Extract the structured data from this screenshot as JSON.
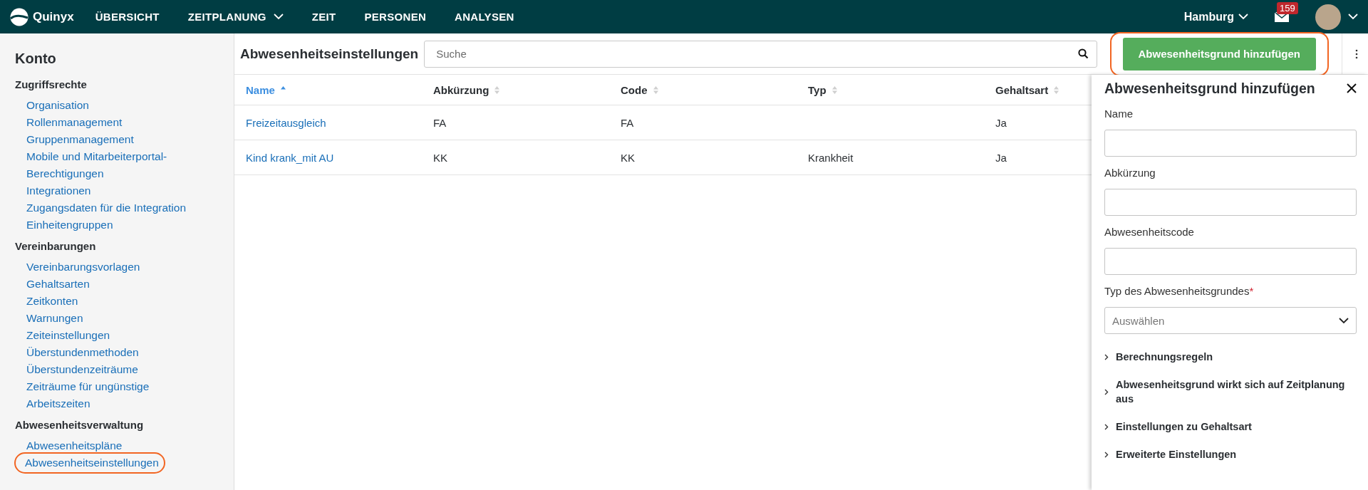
{
  "topbar": {
    "brand": "Quinyx",
    "nav": [
      {
        "label": "ÜBERSICHT",
        "has_menu": false
      },
      {
        "label": "ZEITPLANUNG",
        "has_menu": true
      },
      {
        "label": "ZEIT",
        "has_menu": false
      },
      {
        "label": "PERSONEN",
        "has_menu": false
      },
      {
        "label": "ANALYSEN",
        "has_menu": false
      }
    ],
    "location": "Hamburg",
    "message_count": "159"
  },
  "sidebar": {
    "title": "Konto",
    "groups": [
      {
        "heading": "Zugriffsrechte",
        "items": [
          {
            "label": "Organisation",
            "highlighted": false
          },
          {
            "label": "Rollenmanagement",
            "highlighted": false
          },
          {
            "label": "Gruppenmanagement",
            "highlighted": false
          },
          {
            "label": "Mobile und Mitarbeiterportal-Berechtigungen",
            "highlighted": false
          },
          {
            "label": "Integrationen",
            "highlighted": false
          },
          {
            "label": "Zugangsdaten für die Integration",
            "highlighted": false
          },
          {
            "label": "Einheitengruppen",
            "highlighted": false
          }
        ]
      },
      {
        "heading": "Vereinbarungen",
        "items": [
          {
            "label": "Vereinbarungsvorlagen",
            "highlighted": false
          },
          {
            "label": "Gehaltsarten",
            "highlighted": false
          },
          {
            "label": "Zeitkonten",
            "highlighted": false
          },
          {
            "label": "Warnungen",
            "highlighted": false
          },
          {
            "label": "Zeiteinstellungen",
            "highlighted": false
          },
          {
            "label": "Überstundenmethoden",
            "highlighted": false
          },
          {
            "label": "Überstundenzeiträume",
            "highlighted": false
          },
          {
            "label": "Zeiträume für ungünstige",
            "highlighted": false
          },
          {
            "label": "Arbeitszeiten",
            "highlighted": false
          }
        ]
      },
      {
        "heading": "Abwesenheitsverwaltung",
        "items": [
          {
            "label": "Abwesenheitspläne",
            "highlighted": false
          },
          {
            "label": "Abwesenheitseinstellungen",
            "highlighted": true
          }
        ]
      }
    ]
  },
  "page": {
    "title": "Abwesenheitseinstellungen",
    "search": {
      "placeholder": "Suche"
    },
    "add_button": {
      "label": "Abwesenheitsgrund hinzufügen",
      "highlighted": true
    }
  },
  "table": {
    "columns": [
      {
        "label": "Name",
        "sorted": true
      },
      {
        "label": "Abkürzung",
        "sorted": false
      },
      {
        "label": "Code",
        "sorted": false
      },
      {
        "label": "Typ",
        "sorted": false
      },
      {
        "label": "Gehaltsart",
        "sorted": false
      }
    ],
    "rows": [
      [
        "Freizeitausgleich",
        "FA",
        "FA",
        "",
        "Ja"
      ],
      [
        "Kind krank_mit AU",
        "KK",
        "KK",
        "Krankheit",
        "Ja"
      ]
    ]
  },
  "panel": {
    "title": "Abwesenheitsgrund hinzufügen",
    "fields": [
      {
        "kind": "text",
        "label": "Name"
      },
      {
        "kind": "text",
        "label": "Abkürzung"
      },
      {
        "kind": "text",
        "label": "Abwesenheitscode"
      },
      {
        "kind": "select",
        "label": "Typ des Abwesenheitsgrundes",
        "required_mark": "*",
        "placeholder": "Auswählen"
      }
    ],
    "sections": [
      {
        "label": "Berechnungsregeln",
        "expanded": false
      },
      {
        "label": "Abwesenheitsgrund wirkt sich auf Zeitplanung aus",
        "expanded": false
      },
      {
        "label": "Einstellungen zu Gehaltsart",
        "expanded": false
      },
      {
        "label": "Erweiterte Einstellungen",
        "expanded": false
      }
    ]
  }
}
